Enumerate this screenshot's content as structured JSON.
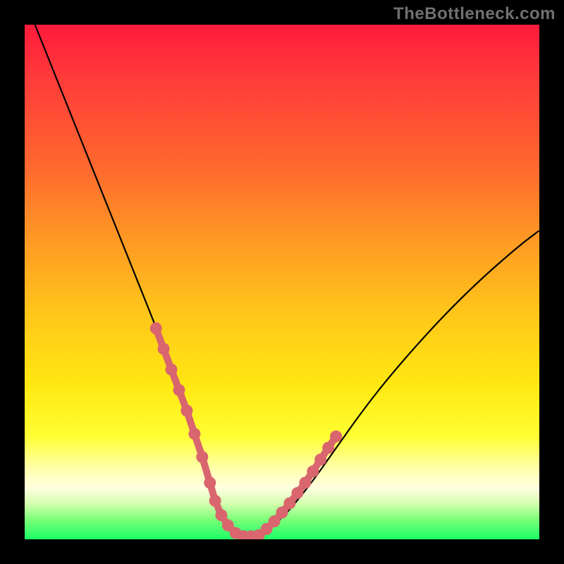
{
  "watermark": "TheBottleneck.com",
  "chart_data": {
    "type": "line",
    "title": "",
    "xlabel": "",
    "ylabel": "",
    "xlim": [
      0,
      100
    ],
    "ylim": [
      0,
      100
    ],
    "series": [
      {
        "name": "bottleneck-curve",
        "x": [
          2,
          6,
          10,
          14,
          18,
          22,
          26,
          30,
          32,
          34,
          36,
          37.5,
          39,
          41,
          43,
          46,
          50,
          55,
          60,
          66,
          72,
          80,
          88,
          96,
          100
        ],
        "y": [
          100,
          90,
          80,
          70,
          60,
          50,
          40,
          29,
          23,
          17,
          11,
          6,
          3,
          1,
          0.5,
          1,
          4,
          10,
          17,
          25.5,
          33,
          42,
          50,
          57,
          60
        ]
      }
    ],
    "highlight_segments": [
      {
        "name": "left-descent-dots",
        "x": [
          25.5,
          27.0,
          28.5,
          30.0,
          31.5,
          33.0,
          34.5,
          36.0,
          37.0,
          38.2,
          39.5,
          41.0,
          42.5,
          44.0
        ],
        "y": [
          41.0,
          37.0,
          33.0,
          29.0,
          25.0,
          20.5,
          16.0,
          11.0,
          7.5,
          4.7,
          2.7,
          1.2,
          0.6,
          0.6
        ]
      },
      {
        "name": "right-ascent-dots",
        "x": [
          45.5,
          47.0,
          48.5,
          50.0,
          51.5,
          53.0,
          54.5,
          56.0,
          57.5,
          59.0,
          60.5
        ],
        "y": [
          0.8,
          2.0,
          3.5,
          5.2,
          7.0,
          9.0,
          11.0,
          13.2,
          15.5,
          17.8,
          20.0
        ]
      }
    ],
    "colors": {
      "curve_stroke": "#000000",
      "highlight_fill": "#d9656e",
      "gradient_top": "#ff1a3c",
      "gradient_bottom": "#1aff66"
    }
  }
}
